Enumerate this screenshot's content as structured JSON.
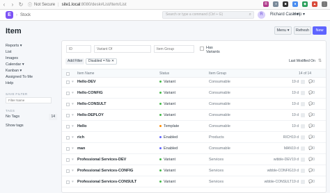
{
  "browser": {
    "not_secure": "Not Secure",
    "host": "site1.local",
    "path": ":8080/desk#List/Item/List",
    "extensions": [
      {
        "label": "R",
        "color": "#b03a8a"
      },
      {
        "label": "◑",
        "color": "#7a8a99"
      },
      {
        "label": "■",
        "color": "#333333"
      },
      {
        "label": "●",
        "color": "#4a8df0"
      },
      {
        "label": "◆",
        "color": "#2c9f5c"
      },
      {
        "label": "▲",
        "color": "#d84a3a"
      },
      {
        "label": "⋮",
        "color": "#777777"
      }
    ]
  },
  "navbar": {
    "logo": "E",
    "breadcrumb": "Stock",
    "search_placeholder": "Search or type a command (Ctrl + G)",
    "avatar": "R",
    "user": "Richard Case ▾",
    "help": "Help ▾"
  },
  "page": {
    "title": "Item",
    "menu_label": "Menu ▾",
    "refresh_label": "Refresh",
    "new_label": "New"
  },
  "sidebar": {
    "items": [
      "Reports ▾",
      "List",
      "Images",
      "Calendar ▾",
      "Kanban ▾",
      "Assigned To Me",
      "Help"
    ],
    "save_filter_label": "SAVE FILTER",
    "filter_placeholder": "Filter Name",
    "tags_label": "TAGS",
    "no_tags": "No Tags",
    "no_tags_count": "14",
    "show_tags": "Show tags"
  },
  "filters": {
    "id_placeholder": "ID",
    "variant_of_placeholder": "Variant Of",
    "item_group_placeholder": "Item Group",
    "has_variants_label": "Has Variants",
    "add_filter": "Add Filter",
    "active_filter": "Disabled = No ✕",
    "sort_label": "Last Modified On",
    "sort_icon": "⇅"
  },
  "list": {
    "headers": {
      "name": "Item Name",
      "status": "Status",
      "group": "Item Group",
      "count": "14 of 14"
    },
    "rows": [
      {
        "name": "Hello-DEV",
        "status": "Variant",
        "status_color": "#44b849",
        "group": "Consumable",
        "attr": "",
        "age": "19 d",
        "comments": "0"
      },
      {
        "name": "Hello-CONFIG",
        "status": "Variant",
        "status_color": "#44b849",
        "group": "Consumable",
        "attr": "",
        "age": "19 d",
        "comments": "0"
      },
      {
        "name": "Hello-CONSULT",
        "status": "Variant",
        "status_color": "#44b849",
        "group": "Consumable",
        "attr": "",
        "age": "19 d",
        "comments": "0"
      },
      {
        "name": "Hello-DEPLOY",
        "status": "Variant",
        "status_color": "#44b849",
        "group": "Consumable",
        "attr": "",
        "age": "19 d",
        "comments": "0"
      },
      {
        "name": "Hello",
        "status": "Template",
        "status_color": "#ff8c00",
        "group": "Consumable",
        "attr": "",
        "age": "19 d",
        "comments": "0"
      },
      {
        "name": "rich",
        "status": "Enabled",
        "status_color": "#5e64ff",
        "group": "Products",
        "attr": "RICH",
        "age": "19 d",
        "comments": "0"
      },
      {
        "name": "man",
        "status": "Enabled",
        "status_color": "#5e64ff",
        "group": "Consumable",
        "attr": "MAN",
        "age": "19 d",
        "comments": "0"
      },
      {
        "name": "Professional Services-DEV",
        "status": "Variant",
        "status_color": "#44b849",
        "group": "Services",
        "attr": "wibble-DEV",
        "age": "19 d",
        "comments": "0"
      },
      {
        "name": "Professional Services-CONFIG",
        "status": "Variant",
        "status_color": "#44b849",
        "group": "Services",
        "attr": "wibble-CONFIG",
        "age": "19 d",
        "comments": "0"
      },
      {
        "name": "Professional Services-CONSULT",
        "status": "Variant",
        "status_color": "#44b849",
        "group": "Services",
        "attr": "wibble-CONSULT",
        "age": "19 d",
        "comments": "0"
      }
    ]
  }
}
